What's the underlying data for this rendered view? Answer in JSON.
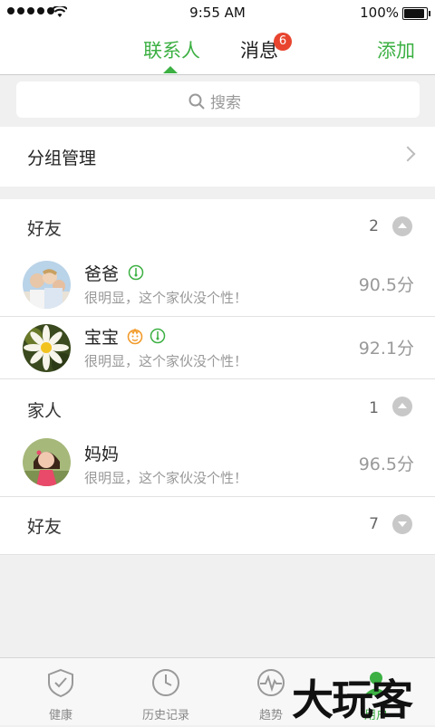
{
  "status_bar": {
    "time": "9:55 AM",
    "battery": "100%",
    "battery_level": 1.0
  },
  "nav": {
    "tabs": [
      {
        "label": "联系人",
        "active": true
      },
      {
        "label": "消息",
        "badge": "6"
      }
    ],
    "add_label": "添加"
  },
  "search": {
    "placeholder": "搜索"
  },
  "group_manage": {
    "label": "分组管理"
  },
  "groups": [
    {
      "name": "好友",
      "count": "2",
      "expanded": true,
      "contacts": [
        {
          "name": "爸爸",
          "status": "很明显，这个家伙没个性！",
          "score": "90.5分"
        },
        {
          "name": "宝宝",
          "status": "很明显，这个家伙没个性！",
          "score": "92.1分"
        }
      ]
    },
    {
      "name": "家人",
      "count": "1",
      "expanded": true,
      "contacts": [
        {
          "name": "妈妈",
          "status": "很明显，这个家伙没个性！",
          "score": "96.5分"
        }
      ]
    },
    {
      "name": "好友",
      "count": "7",
      "expanded": false,
      "contacts": []
    }
  ],
  "bottom_nav": [
    {
      "label": "健康",
      "icon": "shield-icon"
    },
    {
      "label": "历史记录",
      "icon": "clock-icon"
    },
    {
      "label": "趋势",
      "icon": "pulse-icon"
    },
    {
      "label": "用户",
      "icon": "user-icon",
      "active": true
    }
  ],
  "watermark": "大玩客",
  "colors": {
    "accent": "#3cb043",
    "badge": "#e8442e",
    "background": "#f0f0f0"
  }
}
